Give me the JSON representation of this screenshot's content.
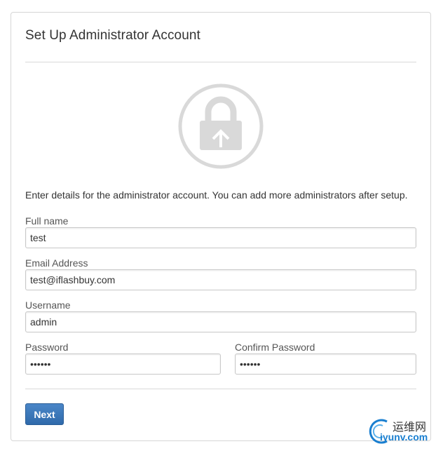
{
  "page": {
    "title": "Set Up Administrator Account",
    "intro": "Enter details for the administrator account. You can add more administrators after setup."
  },
  "icons": {
    "lock": "lock-upload-icon"
  },
  "form": {
    "fullname": {
      "label": "Full name",
      "value": "test"
    },
    "email": {
      "label": "Email Address",
      "value": "test@iflashbuy.com"
    },
    "username": {
      "label": "Username",
      "value": "admin"
    },
    "password": {
      "label": "Password",
      "value": "••••••"
    },
    "confirm": {
      "label": "Confirm Password",
      "value": "••••••"
    }
  },
  "actions": {
    "next_label": "Next"
  },
  "watermark": {
    "line1": "运维网",
    "line2": "iyunv.com"
  },
  "colors": {
    "primary": "#3b77ba",
    "icon_gray": "#d9d9d9",
    "border": "#d6d6d6"
  }
}
